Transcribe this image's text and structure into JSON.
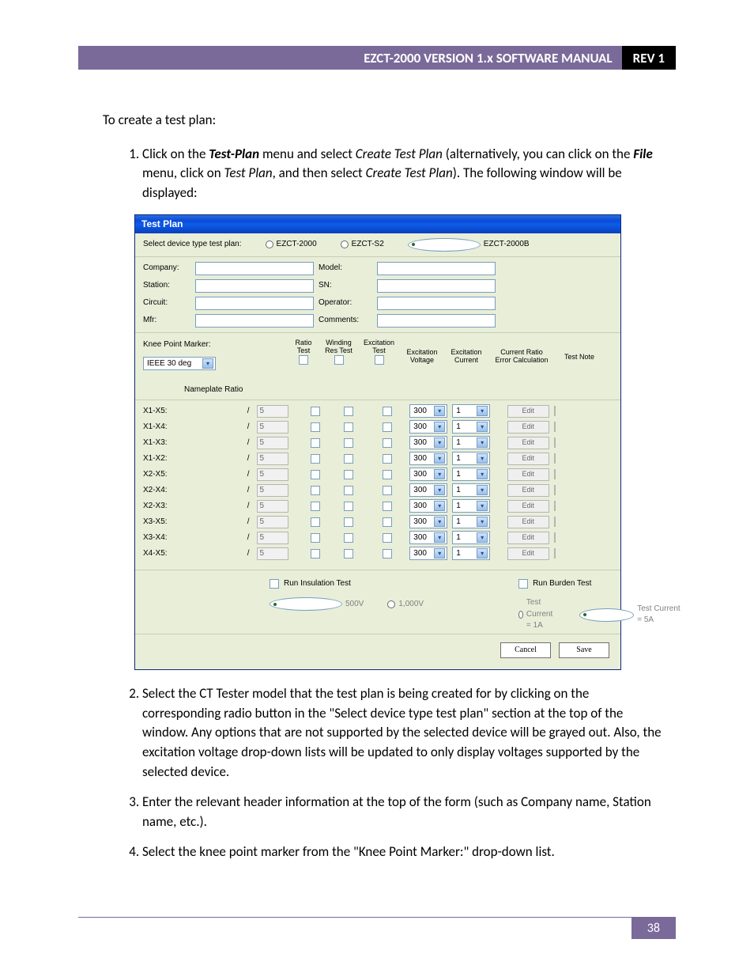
{
  "header": {
    "title": "EZCT-2000 VERSION 1.x SOFTWARE MANUAL",
    "rev": "REV 1"
  },
  "intro": "To create a test plan:",
  "steps": {
    "s1a": "Click on the ",
    "s1_testplan": "Test-Plan",
    "s1b": " menu and select ",
    "s1_create": "Create Test Plan",
    "s1c": " (alternatively, you can click on the ",
    "s1_file": "File",
    "s1d": " menu, click on ",
    "s1_tp2": "Test Plan",
    "s1e": ", and then select ",
    "s1_create2": "Create Test Plan",
    "s1f": "). The following window will be displayed:",
    "s2": "Select the CT Tester model that the test plan is being created for by clicking on the corresponding radio button in the \"Select device type test plan\" section at the top of the window. Any options that are not supported by the selected device will be grayed out. Also, the excitation voltage drop-down lists will be updated to only display voltages supported by the selected device.",
    "s3": "Enter the relevant header information at the top of the form (such as Company name, Station name, etc.).",
    "s4": "Select the knee point marker from the \"Knee Point Marker:\" drop-down list."
  },
  "dialog": {
    "title": "Test Plan",
    "device_label": "Select device type test plan:",
    "radios": {
      "r1": "EZCT-2000",
      "r2": "EZCT-S2",
      "r3": "EZCT-2000B"
    },
    "fields": {
      "company": "Company:",
      "station": "Station:",
      "circuit": "Circuit:",
      "mfr": "Mfr:",
      "model": "Model:",
      "sn": "SN:",
      "operator": "Operator:",
      "comments": "Comments:"
    },
    "knee_label": "Knee Point Marker:",
    "knee_value": "IEEE 30 deg",
    "nameplate_ratio": "Nameplate Ratio",
    "cols": {
      "ratio": "Ratio\nTest",
      "winding": "Winding\nRes Test",
      "excit_test": "Excitation\nTest",
      "excit_v": "Excitation\nVoltage",
      "excit_c": "Excitation\nCurrent",
      "err": "Current Ratio\nError Calculation",
      "note": "Test Note"
    },
    "rows": [
      {
        "tag": "X1-X5:",
        "val": "5",
        "ev": "300",
        "ec": "1"
      },
      {
        "tag": "X1-X4:",
        "val": "5",
        "ev": "300",
        "ec": "1"
      },
      {
        "tag": "X1-X3:",
        "val": "5",
        "ev": "300",
        "ec": "1"
      },
      {
        "tag": "X1-X2:",
        "val": "5",
        "ev": "300",
        "ec": "1"
      },
      {
        "tag": "X2-X5:",
        "val": "5",
        "ev": "300",
        "ec": "1"
      },
      {
        "tag": "X2-X4:",
        "val": "5",
        "ev": "300",
        "ec": "1"
      },
      {
        "tag": "X2-X3:",
        "val": "5",
        "ev": "300",
        "ec": "1"
      },
      {
        "tag": "X3-X5:",
        "val": "5",
        "ev": "300",
        "ec": "1"
      },
      {
        "tag": "X3-X4:",
        "val": "5",
        "ev": "300",
        "ec": "1"
      },
      {
        "tag": "X4-X5:",
        "val": "5",
        "ev": "300",
        "ec": "1"
      }
    ],
    "edit": "Edit",
    "run_ins": "Run Insulation Test",
    "ins_500": "500V",
    "ins_1000": "1,000V",
    "run_bur": "Run Burden Test",
    "bur_1a": "Test Current = 1A",
    "bur_5a": "Test Current = 5A",
    "cancel": "Cancel",
    "save": "Save"
  },
  "page_number": "38"
}
